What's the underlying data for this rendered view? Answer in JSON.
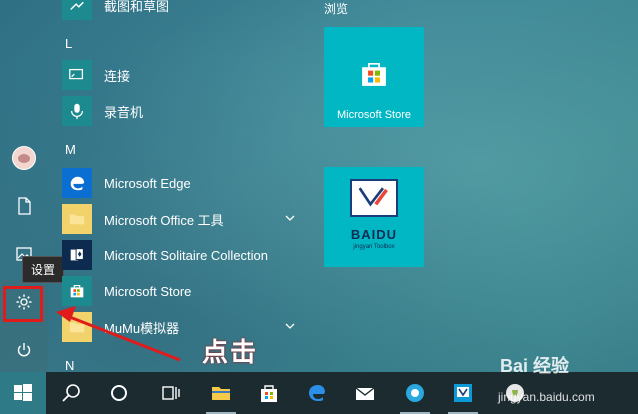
{
  "tooltip": "设置",
  "letters": {
    "L": "L",
    "M": "M",
    "N": "N"
  },
  "apps": {
    "snip": "截图和草图",
    "connect": "连接",
    "recorder": "录音机",
    "edge": "Microsoft Edge",
    "office": "Microsoft Office 工具",
    "solitaire": "Microsoft Solitaire Collection",
    "store": "Microsoft Store",
    "mumu": "MuMu模拟器"
  },
  "tiles": {
    "section": "浏览",
    "store": "Microsoft Store",
    "baidu_title": "BAIDU",
    "baidu_sub": "jingyan Toolbox"
  },
  "annotation": {
    "text": "点击"
  },
  "watermark": {
    "brand": "Bai  经验",
    "url": "jingyan.baidu.com"
  },
  "colors": {
    "accent": "#00b7c3",
    "highlight": "#e01b1b",
    "taskbar": "#1c2b30"
  }
}
